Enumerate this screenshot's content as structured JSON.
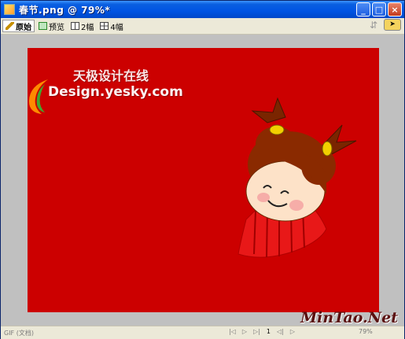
{
  "window": {
    "title": "春节.png @ 79%*",
    "controls": {
      "minimize": "_",
      "maximize": "□",
      "close": "×"
    }
  },
  "toolbar": {
    "tabs": [
      {
        "label": "原始",
        "icon": "pencil-icon",
        "active": true
      },
      {
        "label": "预览",
        "icon": "preview-icon",
        "active": false
      },
      {
        "label": "2幅",
        "icon": "two-up-icon",
        "active": false
      },
      {
        "label": "4幅",
        "icon": "four-up-icon",
        "active": false
      }
    ]
  },
  "canvas": {
    "background_color": "#cc0000",
    "watermark_cn": "天极设计在线",
    "watermark_en": "Design.yesky.com"
  },
  "status": {
    "format": "GIF (文档)",
    "frame": "1",
    "zoom": "79%"
  },
  "brand": "MinTao.Net"
}
